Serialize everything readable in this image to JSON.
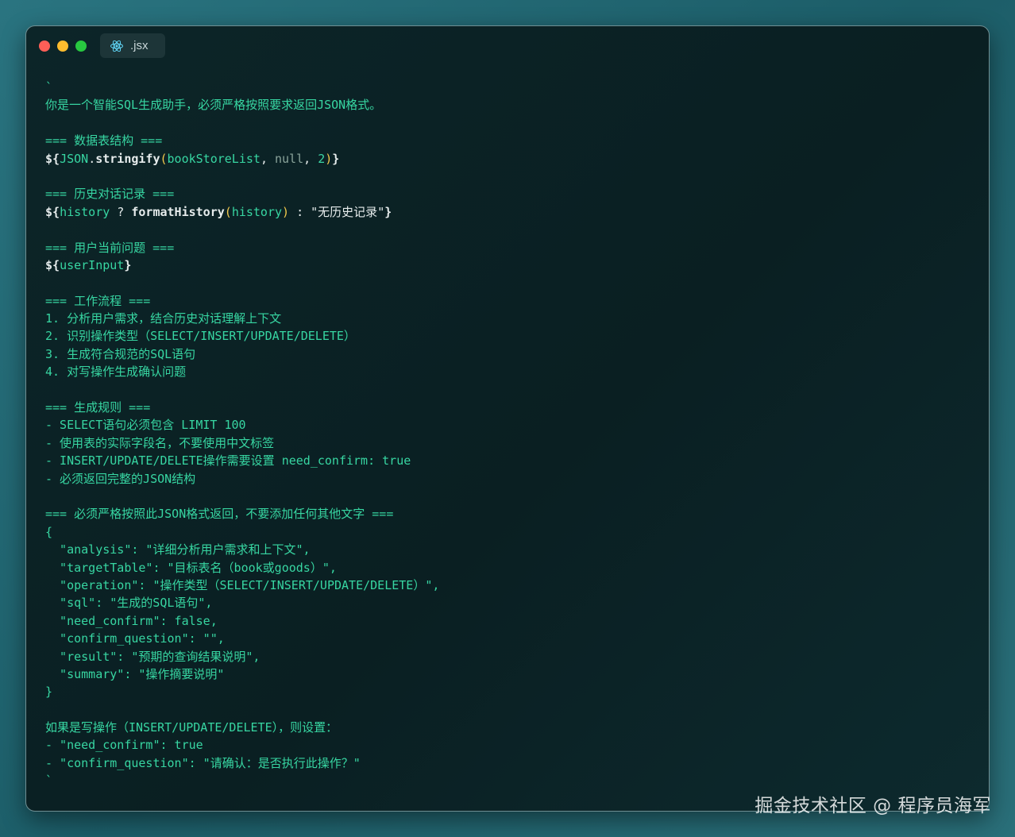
{
  "window": {
    "tab_label": ".jsx",
    "tab_icon": "react-icon"
  },
  "code": {
    "lines": [
      "`",
      "你是一个智能SQL生成助手，必须严格按照要求返回JSON格式。",
      "",
      "=== 数据表结构 ===",
      "${JSON.stringify(bookStoreList, null, 2)}",
      "",
      "=== 历史对话记录 ===",
      "${history ? formatHistory(history) : \"无历史记录\"}",
      "",
      "=== 用户当前问题 ===",
      "${userInput}",
      "",
      "=== 工作流程 ===",
      "1. 分析用户需求，结合历史对话理解上下文",
      "2. 识别操作类型（SELECT/INSERT/UPDATE/DELETE）",
      "3. 生成符合规范的SQL语句",
      "4. 对写操作生成确认问题",
      "",
      "=== 生成规则 ===",
      "- SELECT语句必须包含 LIMIT 100",
      "- 使用表的实际字段名，不要使用中文标签",
      "- INSERT/UPDATE/DELETE操作需要设置 need_confirm: true",
      "- 必须返回完整的JSON结构",
      "",
      "=== 必须严格按照此JSON格式返回，不要添加任何其他文字 ===",
      "{",
      "  \"analysis\": \"详细分析用户需求和上下文\",",
      "  \"targetTable\": \"目标表名（book或goods）\",",
      "  \"operation\": \"操作类型（SELECT/INSERT/UPDATE/DELETE）\",",
      "  \"sql\": \"生成的SQL语句\",",
      "  \"need_confirm\": false,",
      "  \"confirm_question\": \"\",",
      "  \"result\": \"预期的查询结果说明\",",
      "  \"summary\": \"操作摘要说明\"",
      "}",
      "",
      "如果是写操作（INSERT/UPDATE/DELETE），则设置：",
      "- \"need_confirm\": true",
      "- \"confirm_question\": \"请确认：是否执行此操作？\"",
      "`"
    ],
    "tokens": {
      "dollar_brace": "${",
      "close_brace": "}",
      "json": "JSON",
      "dot": ".",
      "stringify": "stringify",
      "paren_open": "(",
      "paren_close": ")",
      "book_store_list": "bookStoreList",
      "comma_space": ", ",
      "null": "null",
      "two": "2",
      "history": "history",
      "ternary_q": " ? ",
      "format_history": "formatHistory",
      "ternary_colon": " : ",
      "no_history": "\"无历史记录\"",
      "user_input": "userInput"
    }
  },
  "watermark": "掘金技术社区 @ 程序员海军",
  "colors": {
    "code_text": "#37d6a2",
    "identifier": "#e6ecec",
    "bracket": "#f2c94c",
    "null_keyword": "#8aa39b",
    "window_bg": "#0a1f22",
    "page_bg": "#1c5d68"
  }
}
